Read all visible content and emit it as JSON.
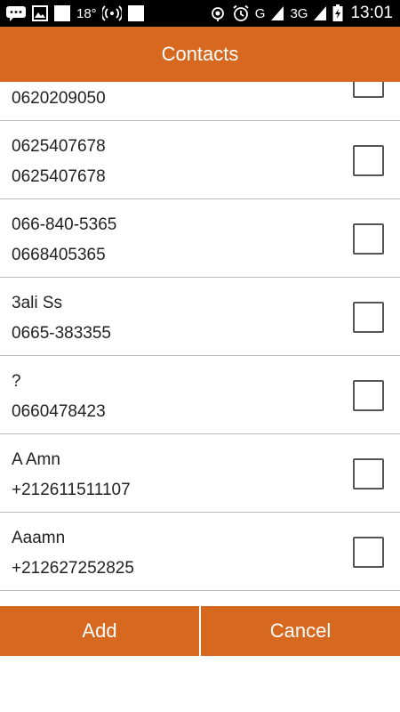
{
  "status_bar": {
    "temperature": "18°",
    "network": "G",
    "network2": "3G",
    "time": "13:01",
    "icons": [
      "chat-icon",
      "image-icon",
      "white-square-icon",
      "wifi-hotspot-icon",
      "white-square-icon",
      "location-icon",
      "alarm-icon",
      "signal-icon",
      "signal-icon",
      "battery-charging-icon"
    ]
  },
  "header": {
    "title": "Contacts"
  },
  "contacts": [
    {
      "name": "0620209050",
      "number": "0620209050"
    },
    {
      "name": "0625407678",
      "number": "0625407678"
    },
    {
      "name": "066-840-5365",
      "number": "0668405365"
    },
    {
      "name": "3ali Ss",
      "number": "0665-383355"
    },
    {
      "name": "?",
      "number": "0660478423"
    },
    {
      "name": "A Amn",
      "number": "+212611511107"
    },
    {
      "name": "Aaamn",
      "number": "+212627252825"
    }
  ],
  "actions": {
    "add_label": "Add",
    "cancel_label": "Cancel"
  },
  "colors": {
    "accent": "#d6691f",
    "divider": "#bdbdbd",
    "text": "#222222"
  }
}
